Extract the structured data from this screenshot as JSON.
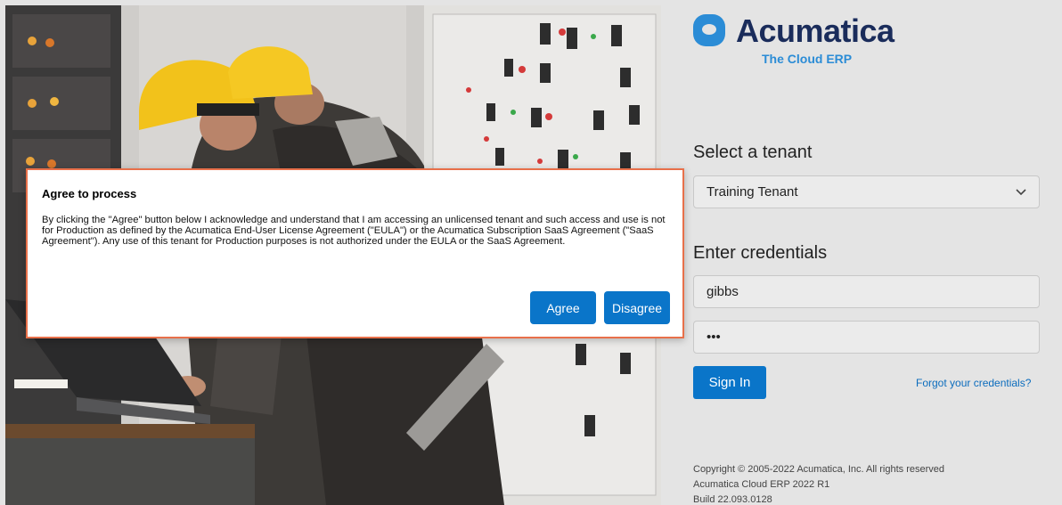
{
  "brand": {
    "name": "Acumatica",
    "tagline": "The Cloud ERP",
    "color": "#1a2c5b",
    "accent": "#2b8cd6"
  },
  "tenant": {
    "heading": "Select a tenant",
    "selected": "Training Tenant",
    "icon": "chevron-down-icon"
  },
  "credentials": {
    "heading": "Enter credentials",
    "username": "gibbs",
    "password_mask": "•••",
    "sign_in_label": "Sign In",
    "forgot_label": "Forgot your credentials?"
  },
  "footer": {
    "copyright": "Copyright © 2005-2022 Acumatica, Inc. All rights reserved",
    "product": "Acumatica Cloud ERP 2022 R1",
    "build": "Build 22.093.0128"
  },
  "dialog": {
    "title": "Agree to process",
    "body": "By clicking the \"Agree\" button below I acknowledge and understand that I am accessing an unlicensed tenant and such access and use is not for Production as defined by the Acumatica End-User License Agreement (\"EULA\") or the Acumatica Subscription SaaS Agreement (\"SaaS Agreement\"). Any use of this tenant for Production purposes is not authorized under the EULA or the SaaS Agreement.",
    "agree_label": "Agree",
    "disagree_label": "Disagree",
    "border_color": "#e8704a"
  },
  "colors": {
    "primary_button": "#0a75c9",
    "link": "#0b6cbd"
  }
}
